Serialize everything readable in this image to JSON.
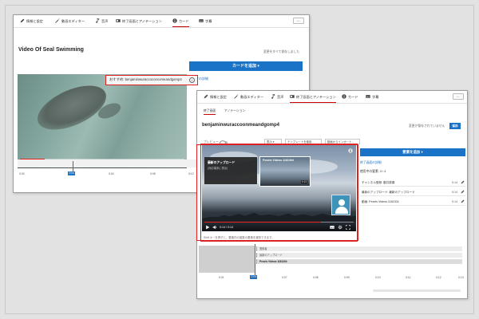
{
  "win1": {
    "tabs": [
      {
        "label": "情報と設定",
        "icon": "pencil-icon"
      },
      {
        "label": "動画エディター",
        "icon": "magic-wand-icon"
      },
      {
        "label": "音声",
        "icon": "music-note-icon"
      },
      {
        "label": "終了画面とアノテーション",
        "icon": "end-screen-icon"
      },
      {
        "label": "カード",
        "icon": "info-icon"
      },
      {
        "label": "字幕",
        "icon": "subtitles-icon"
      }
    ],
    "back_label": "←",
    "video_title": "Video Of Seal Swimming",
    "save_hint": "変更をすべて保存しました",
    "add_card_button": "カードを追加 ▾",
    "card_details_link": "カードの詳細",
    "suggestion_text": "おすすめ: benjaminwuraccoconcomeandgomp4",
    "suggestion_info": "i",
    "player_time": "0:03 / 0:20",
    "progress_fraction": 0.15,
    "timeline_ticks": [
      "0:00",
      "0:04",
      "0:08",
      "0:12"
    ],
    "playhead_label": "0:04"
  },
  "win2": {
    "tabs": [
      {
        "label": "情報と設定",
        "icon": "pencil-icon"
      },
      {
        "label": "動画エディター",
        "icon": "magic-wand-icon"
      },
      {
        "label": "音声",
        "icon": "music-note-icon"
      },
      {
        "label": "終了画面とアノテーション",
        "icon": "end-screen-icon"
      },
      {
        "label": "カード",
        "icon": "info-icon"
      },
      {
        "label": "字幕",
        "icon": "subtitles-icon"
      }
    ],
    "back_label": "←",
    "subtabs": [
      "終了画面",
      "アノテーション"
    ],
    "video_title": "benjaminwuraccoonmeandgomp4",
    "save_hint": "変更が保存されていません",
    "save_button": "保存",
    "preview_label": "プレビュー",
    "toolbar": [
      "表示 ▾",
      "テンプレートを使用...",
      "動画からインポート..."
    ],
    "add_element_button": "要素を追加 ▾",
    "end_screen_details_link": "終了画面の詳細",
    "elements_used": "使用中の要素: 3 / 4",
    "elements": [
      {
        "label": "チャンネル登録: 藤井慶喜",
        "time": "0:14"
      },
      {
        "label": "最新のアップロード: 最新のアップロード",
        "time": "0:14"
      },
      {
        "label": "動画: Pexels Videos 1181304",
        "time": "0:14"
      }
    ],
    "card_latest_title": "最新のアップロード",
    "card_latest_sub": "(対応端末に表示)",
    "card_video_title": "Pexels Videos 1181304",
    "card_video_time": "0:13",
    "player_time": "0:14 / 0:14",
    "progress_fraction": 0.78,
    "hint_text": "Shift キーを押すと、要素内の複数の要素を選択できます。",
    "timeline_rows": [
      "登録者",
      "最新のアップロード",
      "Pexels Videos 1181304"
    ],
    "timeline_ticks": [
      "0:01",
      "0:06",
      "0:07",
      "0:08",
      "0:09",
      "0:10",
      "0:11",
      "0:12",
      "0:13"
    ],
    "playhead_label": "0:06"
  },
  "colors": {
    "accent_blue": "#1a73c7",
    "highlight_red": "#d22222",
    "progress_red": "#ee2222"
  }
}
